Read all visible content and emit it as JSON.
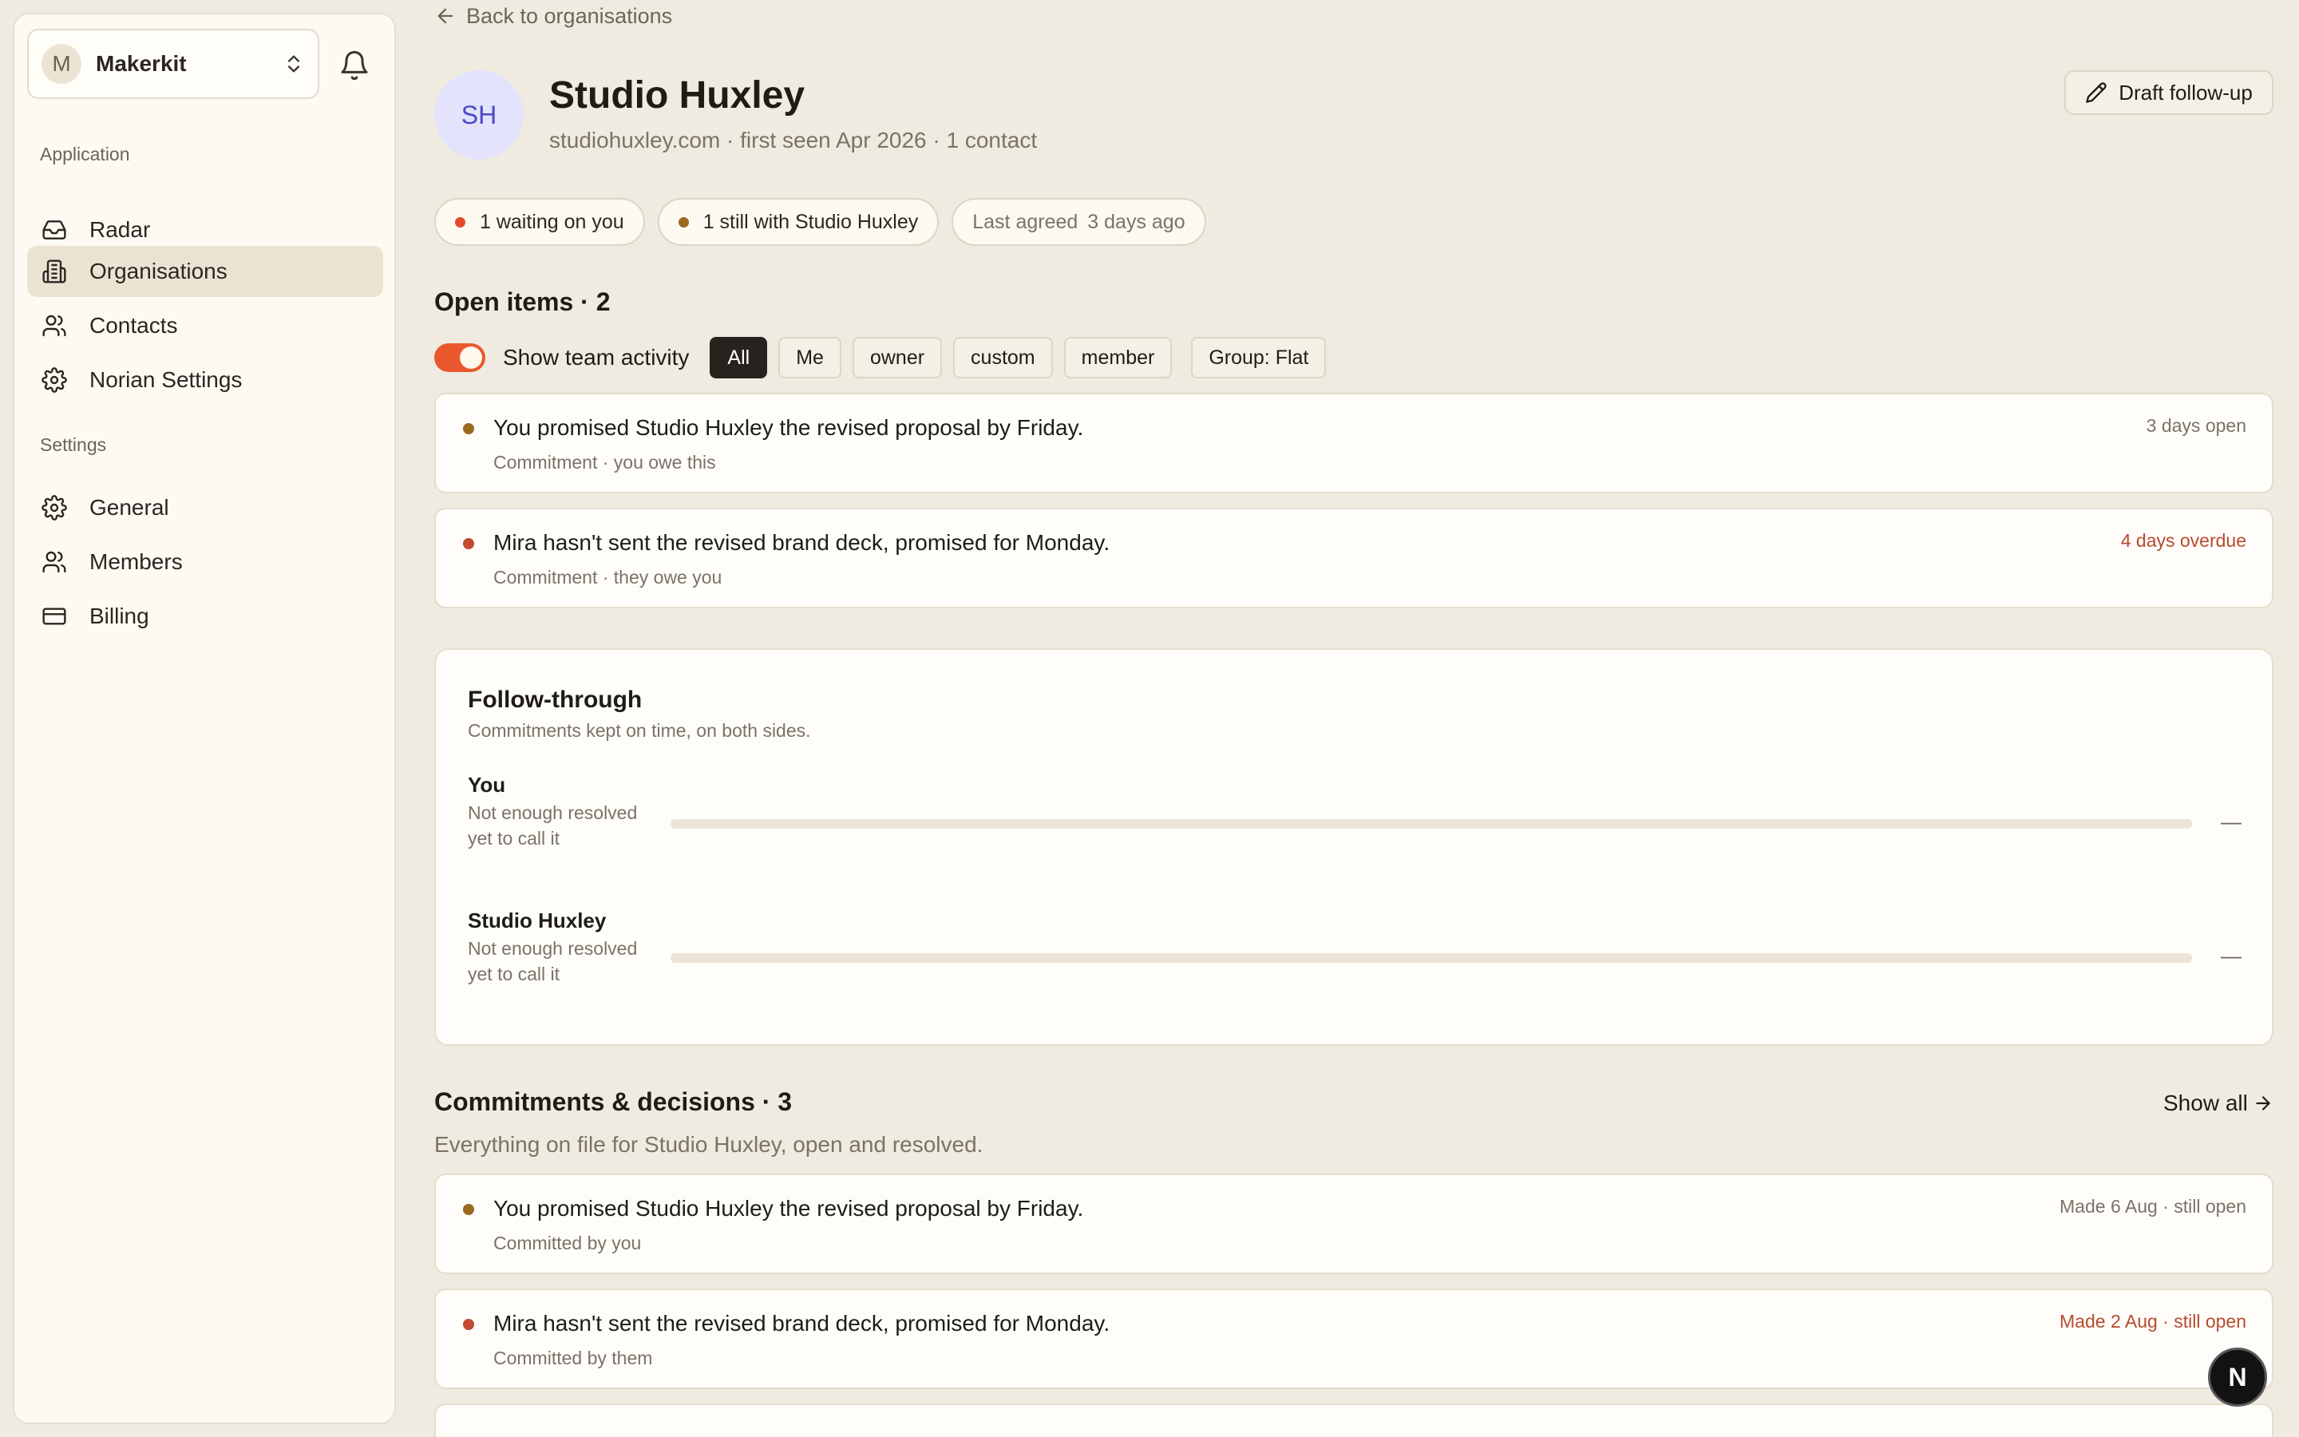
{
  "sidebar": {
    "team": {
      "initial": "M",
      "name": "Makerkit"
    },
    "groups": [
      {
        "label": "Application",
        "items": [
          {
            "label": "Radar",
            "icon": "inbox-icon",
            "active": false
          },
          {
            "label": "Organisations",
            "icon": "building-icon",
            "active": true
          },
          {
            "label": "Contacts",
            "icon": "users-icon",
            "active": false
          },
          {
            "label": "Norian Settings",
            "icon": "gear-icon",
            "active": false
          }
        ]
      },
      {
        "label": "Settings",
        "items": [
          {
            "label": "General",
            "icon": "gear-icon",
            "active": false
          },
          {
            "label": "Members",
            "icon": "users-icon",
            "active": false
          },
          {
            "label": "Billing",
            "icon": "credit-card-icon",
            "active": false
          }
        ]
      }
    ]
  },
  "header": {
    "back_label": "Back to organisations",
    "avatar_initials": "SH",
    "title": "Studio Huxley",
    "meta": "studiohuxley.com · first seen Apr 2026 · 1 contact",
    "draft_label": "Draft follow-up"
  },
  "chips": {
    "waiting": {
      "label": "1 waiting on you",
      "color": "#e24b2e"
    },
    "still": {
      "label": "1 still with Studio Huxley",
      "color": "#9a6a1d"
    },
    "agreed_label": "Last agreed",
    "agreed_value": "3 days ago"
  },
  "open_items": {
    "title": "Open items · 2",
    "toggle_label": "Show team activity",
    "toggle_on": true,
    "filters": [
      "All",
      "Me",
      "owner",
      "custom",
      "member"
    ],
    "active_filter": "All",
    "group_label": "Group: Flat",
    "items": [
      {
        "text": "You promised Studio Huxley the revised proposal by Friday.",
        "sub": "Commitment · you owe this",
        "right": "3 days open",
        "dot": "#9a6a1d",
        "right_red": false
      },
      {
        "text": "Mira hasn't sent the revised brand deck, promised for Monday.",
        "sub": "Commitment · they owe you",
        "right": "4 days overdue",
        "dot": "#c14a33",
        "right_red": true
      }
    ]
  },
  "follow_through": {
    "title": "Follow-through",
    "subtitle": "Commitments kept on time, on both sides.",
    "rows": [
      {
        "name": "You",
        "note": "Not enough resolved yet to call it",
        "value": "—",
        "fill": 0
      },
      {
        "name": "Studio Huxley",
        "note": "Not enough resolved yet to call it",
        "value": "—",
        "fill": 0
      }
    ]
  },
  "commitments": {
    "title": "Commitments & decisions · 3",
    "show_all": "Show all",
    "subtitle": "Everything on file for Studio Huxley, open and resolved.",
    "items": [
      {
        "text": "You promised Studio Huxley the revised proposal by Friday.",
        "sub": "Committed by you",
        "right": "Made 6 Aug · still open",
        "dot": "#9a6a1d",
        "right_red": false
      },
      {
        "text": "Mira hasn't sent the revised brand deck, promised for Monday.",
        "sub": "Committed by them",
        "right": "Made 2 Aug · still open",
        "dot": "#c14a33",
        "right_red": true
      }
    ]
  },
  "dev_badge": "N"
}
